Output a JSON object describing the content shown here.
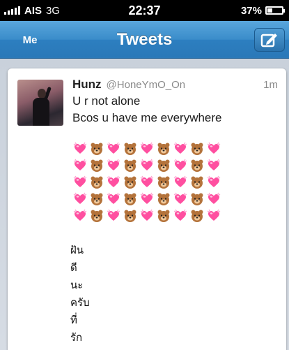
{
  "status_bar": {
    "carrier": "AIS",
    "network": "3G",
    "time": "22:37",
    "battery_percent": "37%",
    "battery_level": 0.37
  },
  "nav": {
    "back_label": "Me",
    "title": "Tweets",
    "compose_icon": "compose-icon"
  },
  "tweet": {
    "name": "Hunz",
    "handle": "@HoneYmO_On",
    "time": "1m",
    "lines": [
      "U r not alone",
      "Bcos u have me everywhere"
    ],
    "emoji_rows": [
      [
        "heart",
        "bear",
        "heart",
        "bear",
        "heart",
        "bear",
        "heart",
        "bear",
        "heart"
      ],
      [
        "heart",
        "bear",
        "heart",
        "bear",
        "heart",
        "bear",
        "heart",
        "bear",
        "heart"
      ],
      [
        "heart",
        "bear",
        "heart",
        "bear",
        "heart",
        "bear",
        "heart",
        "bear",
        "heart"
      ],
      [
        "heart",
        "bear",
        "heart",
        "bear",
        "heart",
        "bear",
        "heart",
        "bear",
        "heart"
      ],
      [
        "heart",
        "bear",
        "heart",
        "bear",
        "heart",
        "bear",
        "heart",
        "bear",
        "heart"
      ]
    ],
    "thai_lines": [
      "ฝัน",
      "ดี",
      "นะ",
      "ครับ",
      "ที่",
      "รัก"
    ]
  },
  "colors": {
    "nav_blue": "#2d7fc0",
    "heart_pink": "#ff4fa0",
    "bear_brown": "#b4733b"
  }
}
